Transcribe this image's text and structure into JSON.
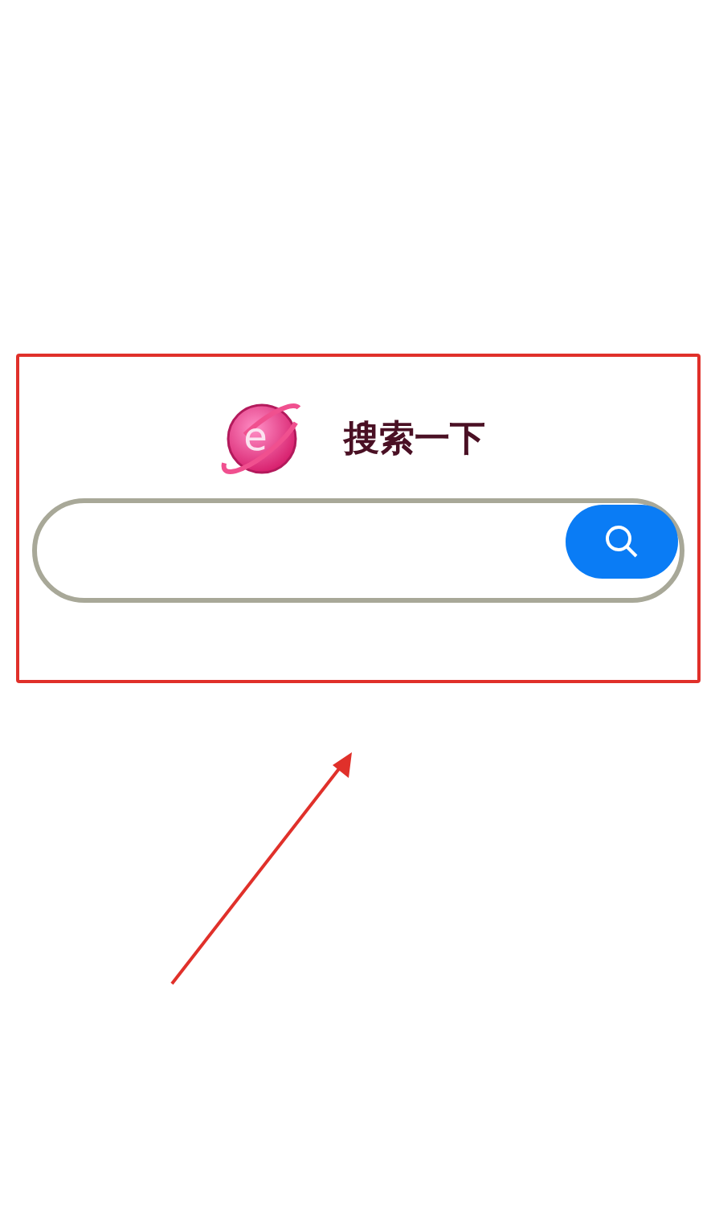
{
  "logo": {
    "letter": "e"
  },
  "title": "搜索一下"
}
